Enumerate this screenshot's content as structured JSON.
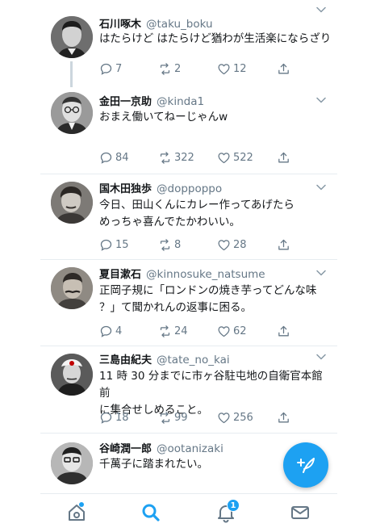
{
  "tweets": [
    {
      "name": "石川啄木",
      "handle": "@taku_boku",
      "text": "はたらけど はたらけど猶わが生活楽にならざり",
      "replies": "7",
      "retweets": "2",
      "likes": "12"
    },
    {
      "name": "金田一京助",
      "handle": "@kinda1",
      "text": "おまえ働いてねーじゃんw",
      "replies": "84",
      "retweets": "322",
      "likes": "522"
    },
    {
      "name": "国木田独歩",
      "handle": "@doppoppo",
      "text_line1": "今日、田山くんにカレー作ってあげたら",
      "text_line2": "めっちゃ喜んでたかわいい。",
      "replies": "15",
      "retweets": "8",
      "likes": "28"
    },
    {
      "name": "夏目漱石",
      "handle": "@kinnosuke_natsume",
      "text_line1": "正岡子規に「ロンドンの焼き芋ってどんな味",
      "text_line2": "？」て聞かれんの返事に困る。",
      "replies": "4",
      "retweets": "24",
      "likes": "62"
    },
    {
      "name": "三島由紀夫",
      "handle": "@tate_no_kai",
      "text_line1": "11 時 30 分までに市ヶ谷駐屯地の自衛官本館前",
      "text_line2": "に集合せしめること。",
      "replies": "18",
      "retweets": "99",
      "likes": "256"
    },
    {
      "name": "谷崎潤一郎",
      "handle": "@ootanizaki",
      "text": "千萬子に踏まれたい。"
    }
  ],
  "tabbar": {
    "notifications_badge": "1",
    "icons": [
      "home-icon",
      "search-icon",
      "bell-icon",
      "mail-icon"
    ]
  },
  "colors": {
    "accent": "#1da1f2",
    "secondary_text": "#657786",
    "divider": "#e6ecf0"
  }
}
